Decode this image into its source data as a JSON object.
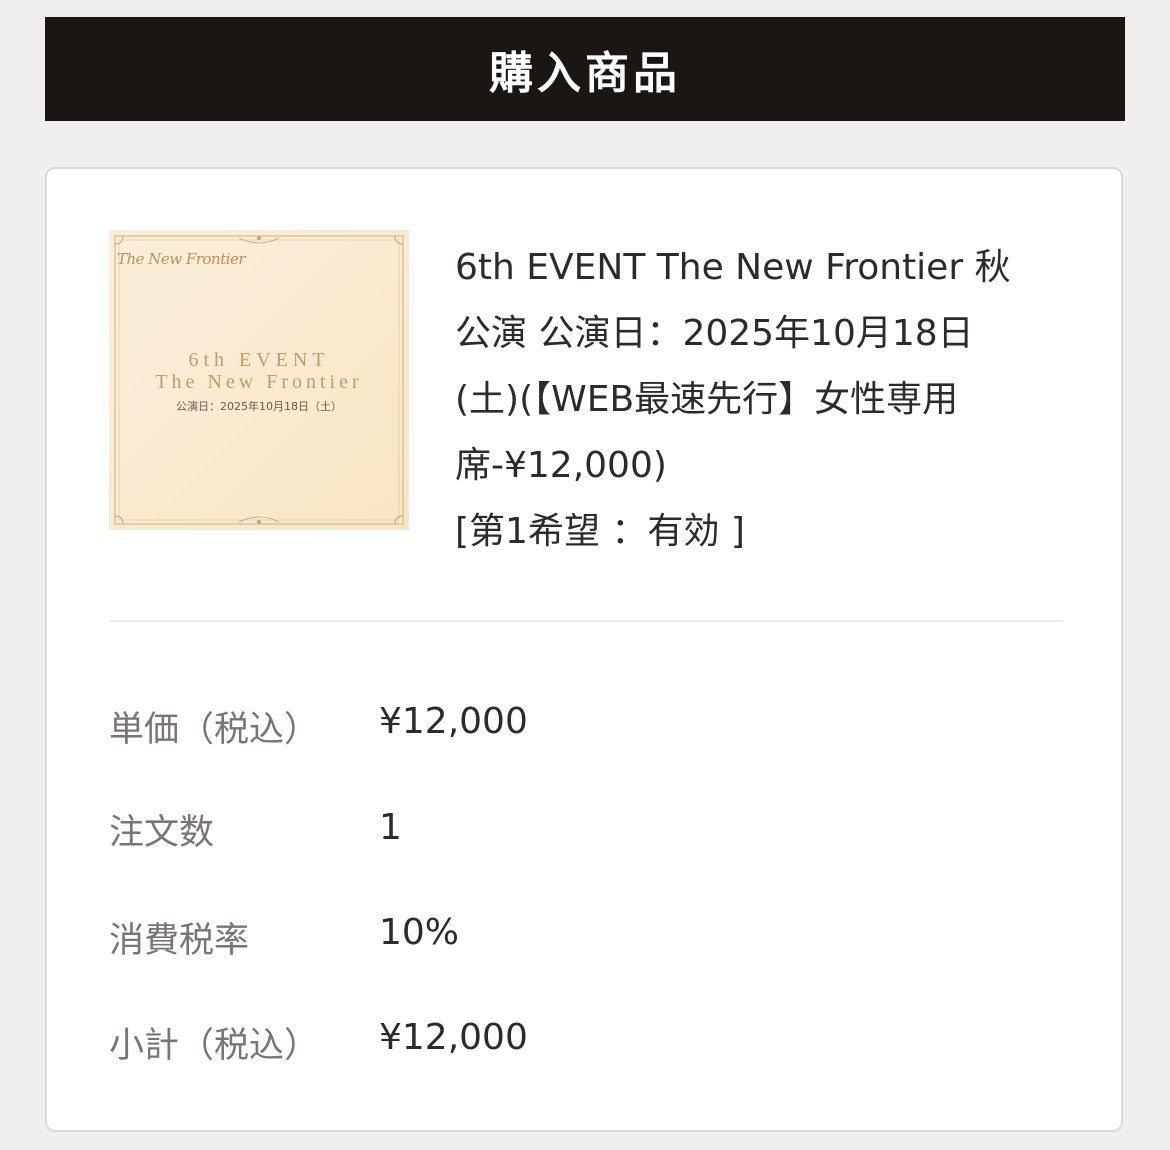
{
  "header": {
    "title": "購入商品"
  },
  "product": {
    "image": {
      "logo_text": "The New Frontier",
      "line1": "6th EVENT",
      "line2": "The New Frontier",
      "line3": "公演日：2025年10月18日（土）"
    },
    "title_lines": [
      "6th EVENT The New Frontier 秋",
      "公演 公演日：2025年10月18日",
      "(土)(【WEB最速先行】女性専用",
      "席-¥12,000)",
      "[第1希望 ：有効 ]"
    ]
  },
  "details": [
    {
      "label": "単価（税込）",
      "value": "¥12,000"
    },
    {
      "label": "注文数",
      "value": "1"
    },
    {
      "label": "消費税率",
      "value": "10%"
    },
    {
      "label": "小計（税込）",
      "value": "¥12,000"
    }
  ],
  "colors": {
    "header_bg": "#1b1514",
    "page_bg": "#f0efee",
    "card_bg": "#ffffff",
    "label_text": "#7a7573",
    "value_text": "#2d2a29",
    "thumb_gold": "#c49a63"
  }
}
